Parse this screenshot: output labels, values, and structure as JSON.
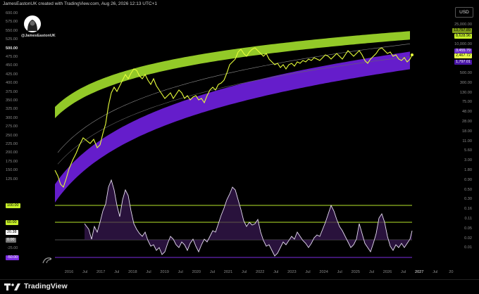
{
  "header": {
    "credit": "JamesEastonUK created with TradingView.com, Aug 26, 2026 12:13 UTC+1"
  },
  "watermark": {
    "handle": "@JamesEastonUK"
  },
  "currency_button": {
    "label": "USD"
  },
  "left_axis": [
    "600.00",
    "575.00",
    "550.00",
    "525.00",
    "500.00",
    "475.00",
    "450.00",
    "425.00",
    "400.00",
    "375.00",
    "350.00",
    "325.00",
    "300.00",
    "275.00",
    "250.00",
    "225.00",
    "200.00",
    "175.00",
    "150.00",
    "125.00"
  ],
  "left_axis_highlight": "500.00",
  "right_axis": [
    "25,000.00",
    "15,000.00",
    "10,000.00",
    "2,000.00",
    "1,200.00",
    "500.00",
    "300.00",
    "130.00",
    "75.00",
    "48.00",
    "28.00",
    "18.00",
    "11.00",
    "5.60",
    "3.00",
    "1.80",
    "0.90",
    "0.50",
    "0.30",
    "0.16",
    "0.11",
    "0.05",
    "0.02",
    "0.01"
  ],
  "price_badges": [
    {
      "text": "13,757.89",
      "bg": "#7f9b1a",
      "fg": "#000"
    },
    {
      "text": "8,628.96",
      "bg": "#c6ef2a",
      "fg": "#000"
    },
    {
      "text": "3,455.79",
      "bg": "#6b2fc8",
      "fg": "#fff"
    },
    {
      "text": "2,467.72",
      "bg": "#e9ff4a",
      "fg": "#000"
    },
    {
      "text": "1,797.01",
      "bg": "#4a16a8",
      "fg": "#fff"
    }
  ],
  "oscillator_badges": [
    {
      "text": "100.00",
      "bg": "#c6ef2a",
      "fg": "#000"
    },
    {
      "text": "60.00",
      "bg": "#c6ef2a",
      "fg": "#000"
    },
    {
      "text": "20.38",
      "bg": "#ffffff",
      "fg": "#000"
    },
    {
      "text": "0.00",
      "bg": "#777777",
      "fg": "#fff"
    },
    {
      "text": "-25.00",
      "bg": "#000000",
      "fg": "#8a8a8a"
    },
    {
      "text": "-50.00",
      "bg": "#7a2be0",
      "fg": "#fff"
    }
  ],
  "x_axis": [
    "2016",
    "Jul",
    "2017",
    "Jul",
    "2018",
    "Jul",
    "2019",
    "Jul",
    "2020",
    "Jul",
    "2021",
    "Jul",
    "2022",
    "Jul",
    "2023",
    "Jul",
    "2024",
    "Jul",
    "2025",
    "Jul",
    "2026",
    "Jul",
    "2027",
    "Jul",
    "20"
  ],
  "x_axis_highlight": "2027",
  "footer": {
    "brand": "TradingView"
  },
  "colors": {
    "upper_band": "#9bd42a",
    "lower_band": "#6a1fd6",
    "price_line": "#e8ff3a",
    "oscillator_line": "#e6dcf2",
    "oscillator_fill": "#3a1a55",
    "level_line": "#b6e62a",
    "zero_line": "#666666",
    "low_line": "#7a2be0"
  }
}
